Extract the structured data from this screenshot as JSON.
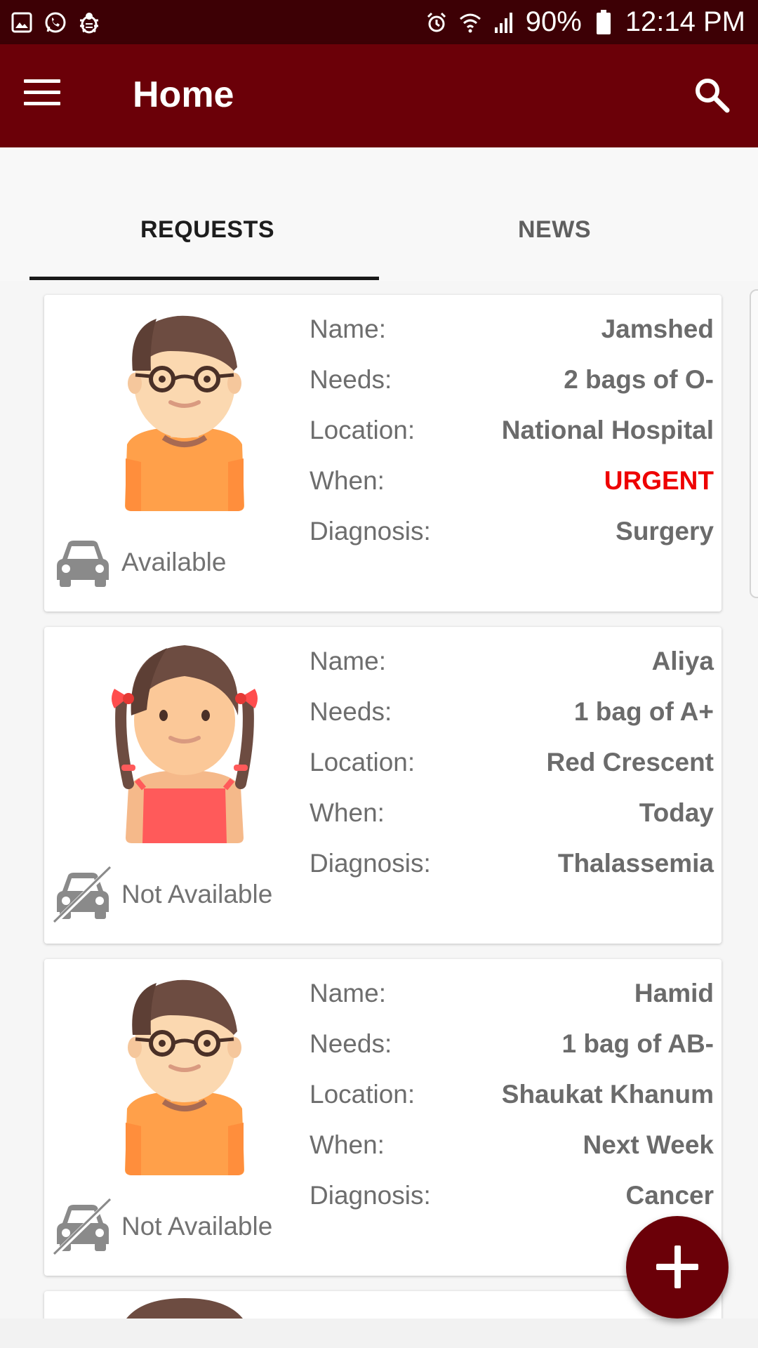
{
  "status_bar": {
    "battery": "90%",
    "time": "12:14 PM",
    "icons_left": [
      "gallery-icon",
      "whatsapp-icon",
      "bug-icon"
    ],
    "icons_right": [
      "alarm-icon",
      "wifi-icon",
      "signal-icon",
      "battery-icon"
    ]
  },
  "app_bar": {
    "title": "Home",
    "menu_icon": "hamburger-menu-icon",
    "search_icon": "search-icon",
    "color": "#6b0008"
  },
  "tabs": [
    {
      "label": "REQUESTS",
      "selected": true
    },
    {
      "label": "NEWS",
      "selected": false
    }
  ],
  "labels": {
    "name": "Name:",
    "needs": "Needs:",
    "location": "Location:",
    "when": "When:",
    "diagnosis": "Diagnosis:"
  },
  "requests": [
    {
      "avatar": "boy-avatar",
      "name": "Jamshed",
      "needs": "2 bags of O-",
      "location": "National Hospital",
      "when": "URGENT",
      "diagnosis": "Surgery",
      "transport": "Available",
      "transport_icon": "car-icon"
    },
    {
      "avatar": "girl-avatar",
      "name": "Aliya",
      "needs": "1 bag of A+",
      "location": "Red Crescent",
      "when": "Today",
      "diagnosis": "Thalassemia",
      "transport": "Not Available",
      "transport_icon": "car-crossed-icon"
    },
    {
      "avatar": "boy-avatar",
      "name": "Hamid",
      "needs": "1 bag of AB-",
      "location": "Shaukat Khanum",
      "when": "Next Week",
      "diagnosis": "Cancer",
      "transport": "Not Available",
      "transport_icon": "car-crossed-icon"
    }
  ],
  "fab": {
    "icon": "plus-icon"
  },
  "colors": {
    "status_bar": "#3d0005",
    "urgent": "#ee0000",
    "text_secondary": "#6d6d6d"
  }
}
